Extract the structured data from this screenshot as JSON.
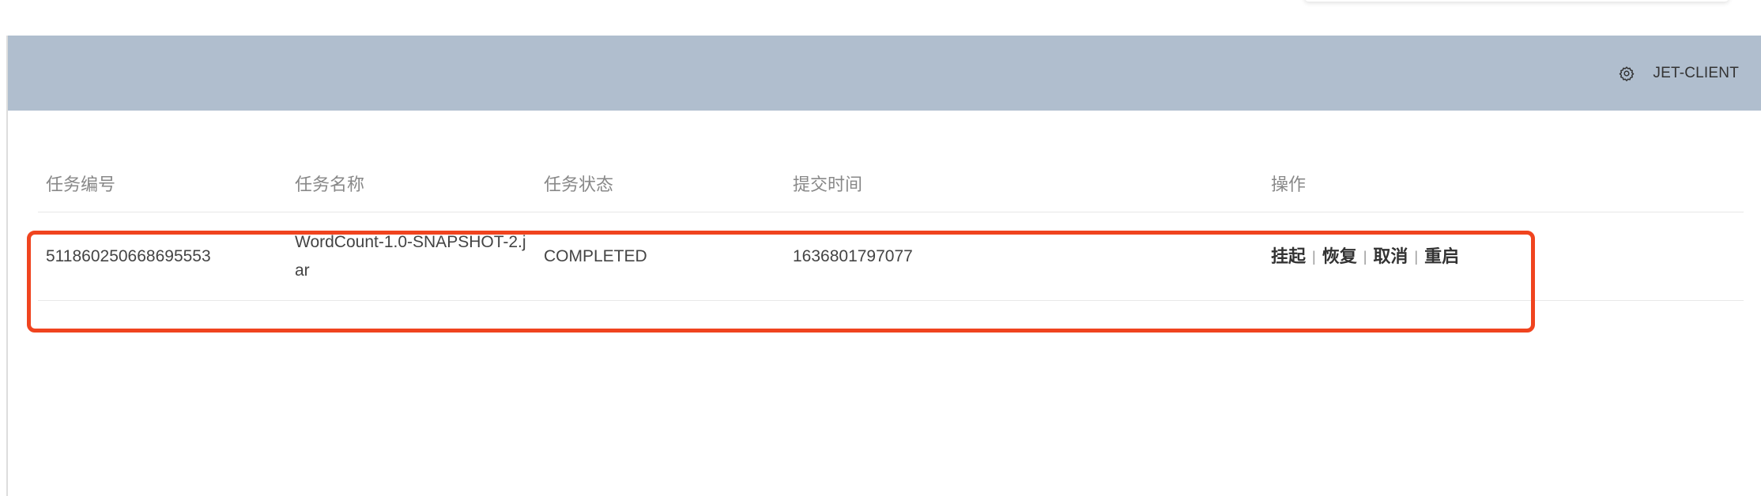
{
  "header": {
    "client_name": "JET-CLIENT",
    "settings_icon": "gear-icon",
    "background_color": "#b0bece"
  },
  "table": {
    "columns": [
      "任务编号",
      "任务名称",
      "任务状态",
      "提交时间",
      "操作"
    ],
    "rows": [
      {
        "id": "511860250668695553",
        "name": "WordCount-1.0-SNAPSHOT-2.jar",
        "status": "COMPLETED",
        "submit_time": "1636801797077",
        "actions": [
          "挂起",
          "恢复",
          "取消",
          "重启"
        ]
      }
    ]
  },
  "highlight_color": "#f0441f"
}
